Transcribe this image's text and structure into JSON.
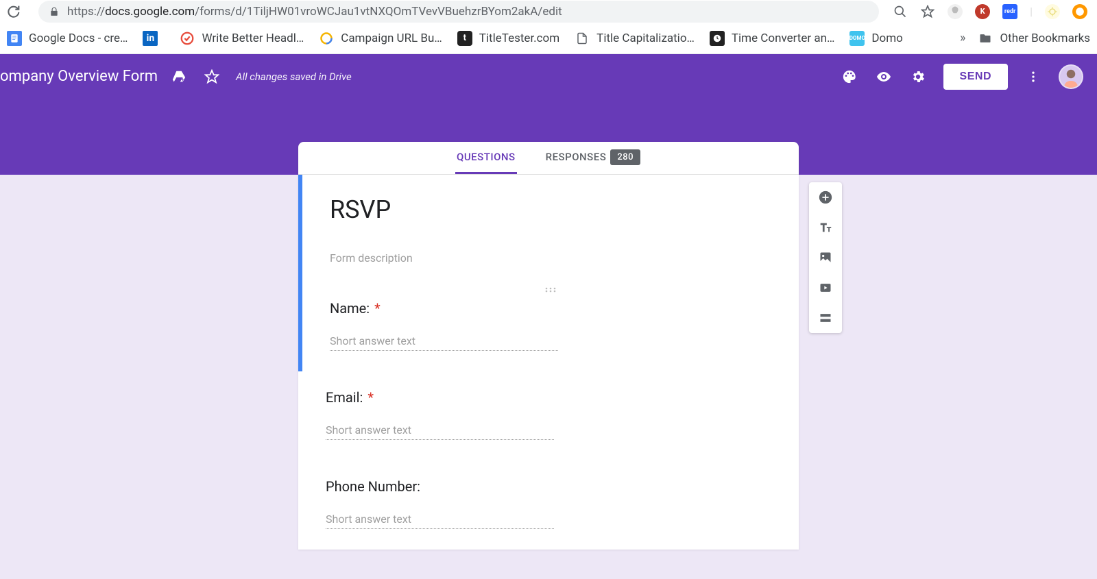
{
  "browser": {
    "url_domain": "docs.google.com",
    "url_path": "/forms/d/1TiljHW01vroWCJau1vtNXQOmTVevVBuehzrBYom2akA/edit",
    "url_prefix": "https://"
  },
  "bookmarks": [
    {
      "label": "Google Docs - cre…",
      "icon": "gdocs"
    },
    {
      "label": "",
      "icon": "linkedin"
    },
    {
      "label": "Write Better Headl…",
      "icon": "cos"
    },
    {
      "label": "Campaign URL Bu…",
      "icon": "ga"
    },
    {
      "label": "TitleTester.com",
      "icon": "tt"
    },
    {
      "label": "Title Capitalizatio…",
      "icon": "page"
    },
    {
      "label": "Time Converter an…",
      "icon": "clock"
    },
    {
      "label": "Domo",
      "icon": "domo"
    }
  ],
  "other_bookmarks_label": "Other Bookmarks",
  "header": {
    "form_name": "ompany Overview Form",
    "save_status": "All changes saved in Drive",
    "send_label": "SEND"
  },
  "tabs": {
    "questions": "QUESTIONS",
    "responses": "RESPONSES",
    "responses_count": "280"
  },
  "form": {
    "title": "RSVP",
    "description_placeholder": "Form description",
    "questions": [
      {
        "label": "Name:",
        "required": true,
        "answer_placeholder": "Short answer text"
      },
      {
        "label": "Email:",
        "required": true,
        "answer_placeholder": "Short answer text"
      },
      {
        "label": "Phone Number:",
        "required": false,
        "answer_placeholder": "Short answer text"
      }
    ]
  }
}
